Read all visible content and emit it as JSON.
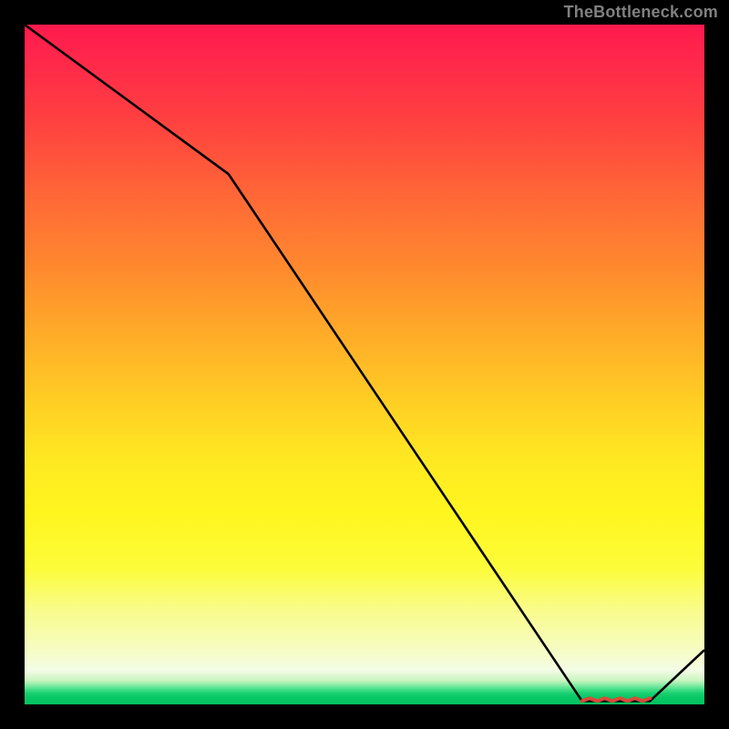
{
  "attribution": "TheBottleneck.com",
  "chart_data": {
    "type": "line",
    "title": "",
    "xlabel": "",
    "ylabel": "",
    "x": [
      0.0,
      0.3,
      0.82,
      0.92,
      1.0
    ],
    "values": [
      1.0,
      0.78,
      0.005,
      0.005,
      0.08
    ],
    "xlim": [
      0,
      1
    ],
    "ylim": [
      0,
      1
    ],
    "min_marker": {
      "x_start": 0.82,
      "x_end": 0.92,
      "y": 0.005
    },
    "notes": "Background is a vertical red→orange→yellow→pale→green gradient. Curve is black. Short jagged red marker segment at the flat minimum."
  }
}
